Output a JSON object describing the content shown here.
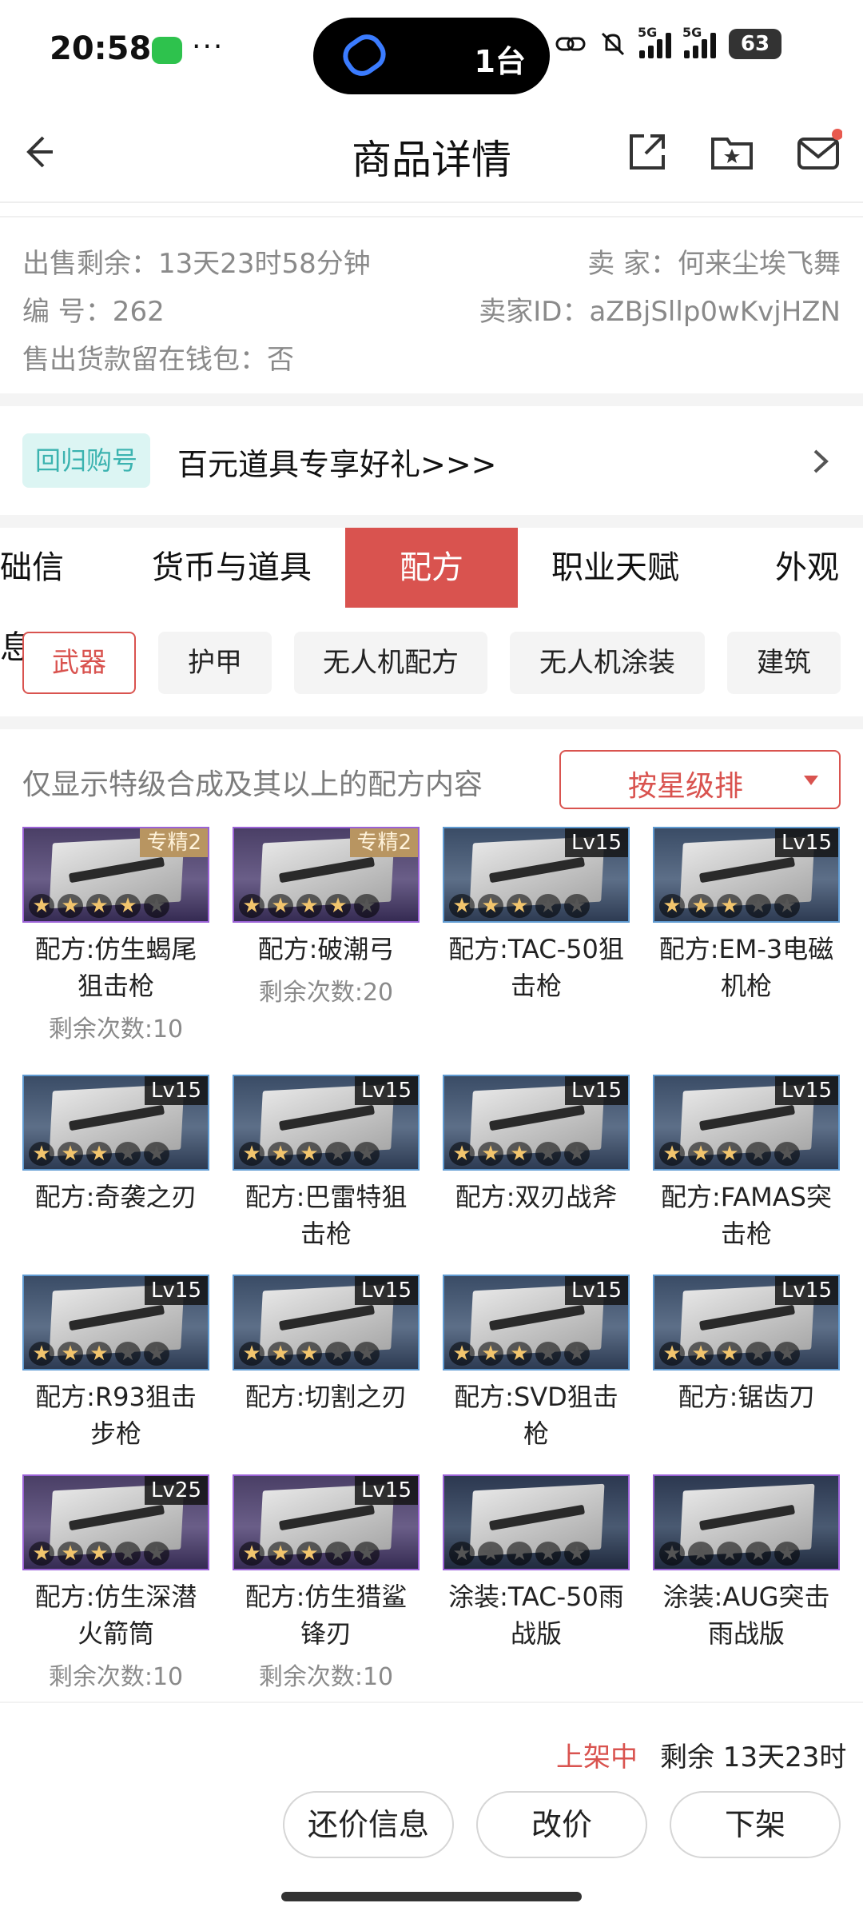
{
  "status_bar": {
    "time": "20:58",
    "dots": "···",
    "island_text": "1台",
    "battery": "63",
    "network": "5G"
  },
  "header": {
    "title": "商品详情"
  },
  "info": {
    "time_left": "出售剩余：13天23时58分钟",
    "seller": "卖  家：何来尘埃飞舞",
    "number": "编  号：262",
    "seller_id": "卖家ID：aZBjSllp0wKvjHZN",
    "wallet": "售出货款留在钱包：否"
  },
  "promo": {
    "badge": "回归购号",
    "text": "百元道具专享好礼>>>"
  },
  "tabs": [
    "础信息",
    "货币与道具",
    "配方",
    "职业天赋",
    "外观"
  ],
  "chips": [
    "武器",
    "护甲",
    "无人机配方",
    "无人机涂装",
    "建筑"
  ],
  "filter": {
    "note": "仅显示特级合成及其以上的配方内容",
    "sort": "按星级排"
  },
  "items": [
    {
      "l1": "配方:仿生蝎尾",
      "l2": "狙击枪",
      "sub": "剩余次数:10",
      "badge": "专精2",
      "stars": 4
    },
    {
      "l1": "配方:破潮弓",
      "l2": "",
      "sub": "剩余次数:20",
      "badge": "专精2",
      "stars": 4
    },
    {
      "l1": "配方:TAC-50狙",
      "l2": "击枪",
      "sub": "",
      "badge": "Lv15",
      "stars": 3
    },
    {
      "l1": "配方:EM-3电磁",
      "l2": "机枪",
      "sub": "",
      "badge": "Lv15",
      "stars": 3
    },
    {
      "l1": "配方:奇袭之刃",
      "l2": "",
      "sub": "",
      "badge": "Lv15",
      "stars": 3
    },
    {
      "l1": "配方:巴雷特狙",
      "l2": "击枪",
      "sub": "",
      "badge": "Lv15",
      "stars": 3
    },
    {
      "l1": "配方:双刃战斧",
      "l2": "",
      "sub": "",
      "badge": "Lv15",
      "stars": 3
    },
    {
      "l1": "配方:FAMAS突",
      "l2": "击枪",
      "sub": "",
      "badge": "Lv15",
      "stars": 3
    },
    {
      "l1": "配方:R93狙击",
      "l2": "步枪",
      "sub": "",
      "badge": "Lv15",
      "stars": 3
    },
    {
      "l1": "配方:切割之刃",
      "l2": "",
      "sub": "",
      "badge": "Lv15",
      "stars": 3
    },
    {
      "l1": "配方:SVD狙击",
      "l2": "枪",
      "sub": "",
      "badge": "Lv15",
      "stars": 3
    },
    {
      "l1": "配方:锯齿刀",
      "l2": "",
      "sub": "",
      "badge": "Lv15",
      "stars": 3
    },
    {
      "l1": "配方:仿生深潜",
      "l2": "火箭筒",
      "sub": "剩余次数:10",
      "badge": "Lv25",
      "stars": 3
    },
    {
      "l1": "配方:仿生猎鲨",
      "l2": "锋刃",
      "sub": "剩余次数:10",
      "badge": "Lv15",
      "stars": 3
    },
    {
      "l1": "涂装:TAC-50雨",
      "l2": "战版",
      "sub": "",
      "badge": "",
      "stars": 0
    },
    {
      "l1": "涂装:AUG突击",
      "l2": "雨战版",
      "sub": "",
      "badge": "",
      "stars": 0
    }
  ],
  "bottom": {
    "status": "上架中",
    "remain": "剩余 13天23时",
    "buttons": [
      "还价信息",
      "改价",
      "下架"
    ]
  },
  "colors": {
    "accent": "#d9534f",
    "promo_bg": "#dcf5f3",
    "promo_fg": "#3bb3b0"
  }
}
